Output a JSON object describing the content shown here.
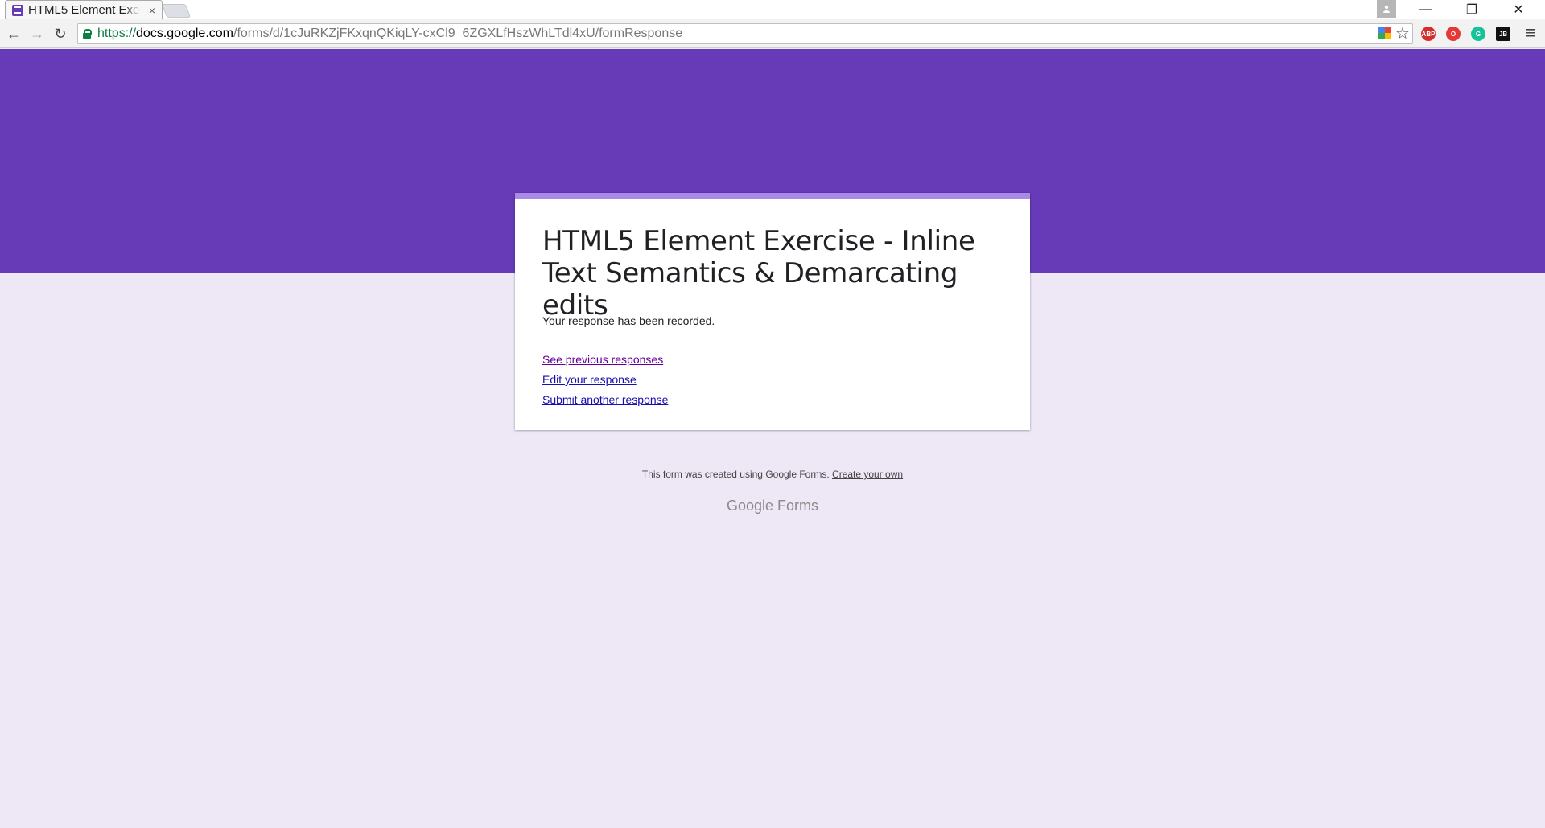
{
  "browser": {
    "tab_title": "HTML5 Element Exercise - Inline Text Semantics & Demarcating edits",
    "tab_close": "×",
    "url_scheme": "https://",
    "url_host": "docs.google.com",
    "url_path": "/forms/d/1cJuRKZjFKxqnQKiqLY-cxCl9_6ZGXLfHszWhLTdl4xU/formResponse",
    "back_icon": "←",
    "forward_icon": "→",
    "reload_icon": "↻",
    "star_icon": "☆",
    "menu_icon": "≡",
    "minimize_icon": "—",
    "restore_icon": "❐",
    "close_icon": "✕",
    "extensions": [
      {
        "name": "abp",
        "label": "ABP",
        "color": "#d32f2f"
      },
      {
        "name": "opera",
        "label": "O",
        "color": "#e53935"
      },
      {
        "name": "grammarly",
        "label": "G",
        "color": "#15c39a"
      },
      {
        "name": "jb",
        "label": "JB",
        "color": "#111111"
      }
    ]
  },
  "form": {
    "title": "HTML5 Element Exercise - Inline Text Semantics & Demarcating edits",
    "confirmation": "Your response has been recorded.",
    "links": {
      "previous": "See previous responses",
      "edit": "Edit your response",
      "another": "Submit another response"
    }
  },
  "footer": {
    "text": "This form was created using Google Forms.",
    "create_link": "Create your own",
    "brand_google": "Google",
    "brand_forms": "Forms"
  },
  "colors": {
    "header": "#673ab7",
    "background": "#ede7f6",
    "card_accent": "#a98ae6"
  }
}
